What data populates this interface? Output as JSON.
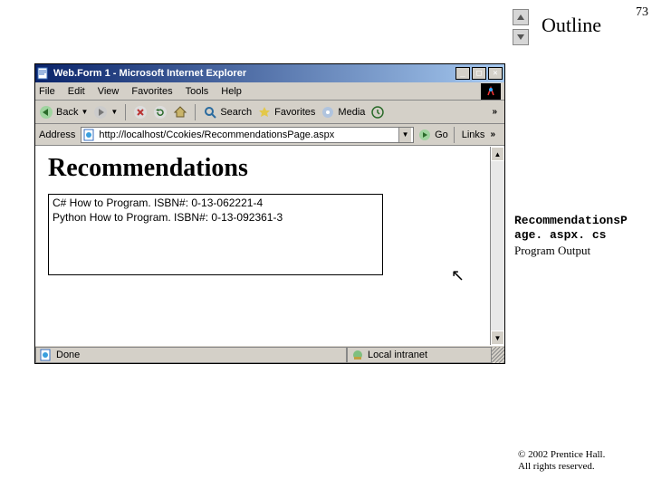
{
  "slide": {
    "outline_label": "Outline",
    "page_number": "73",
    "caption_line1": "RecommendationsP",
    "caption_line2": "age. aspx. cs",
    "caption_line3": "Program Output",
    "copyright_line1": "© 2002 Prentice Hall.",
    "copyright_line2": "All rights reserved."
  },
  "window": {
    "title": "Web.Form 1 - Microsoft Internet Explorer"
  },
  "menu": {
    "file": "File",
    "edit": "Edit",
    "view": "View",
    "favorites": "Favorites",
    "tools": "Tools",
    "help": "Help"
  },
  "toolbar": {
    "back": "Back",
    "search": "Search",
    "favorites": "Favorites",
    "media": "Media"
  },
  "address": {
    "label": "Address",
    "url": "http://localhost/Ccokies/RecommendationsPage.aspx",
    "go": "Go",
    "links": "Links"
  },
  "page": {
    "heading": "Recommendations",
    "listbox": {
      "line1": "C# How to Program. ISBN#: 0-13-062221-4",
      "line2": "Python How to Program. ISBN#: 0-13-092361-3"
    }
  },
  "status": {
    "done": "Done",
    "zone": "Local intranet"
  }
}
